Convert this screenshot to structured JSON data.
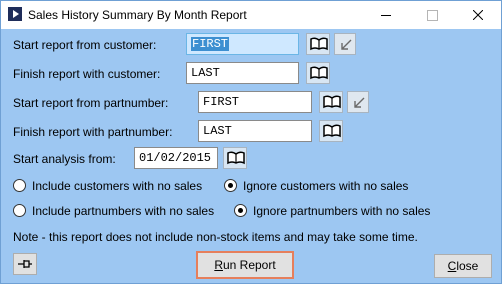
{
  "window": {
    "title": "Sales History Summary By Month Report",
    "controls": [
      "minimize-icon",
      "maximize-icon",
      "close-icon"
    ]
  },
  "form": {
    "start_customer": {
      "label": "Start report from customer:",
      "value": "FIRST"
    },
    "finish_customer": {
      "label": "Finish report with customer:",
      "value": "LAST"
    },
    "start_part": {
      "label": "Start report from partnumber:",
      "value": "FIRST"
    },
    "finish_part": {
      "label": "Finish report with partnumber:",
      "value": "LAST"
    },
    "analysis": {
      "label": "Start analysis from:",
      "value": "01/02/2015"
    }
  },
  "options": {
    "customers": {
      "include": {
        "label": "Include customers with no sales",
        "selected": false
      },
      "ignore": {
        "label": "Ignore customers with no sales",
        "selected": true
      }
    },
    "partnumbers": {
      "include": {
        "label": "Include partnumbers with no sales",
        "selected": false
      },
      "ignore": {
        "label": "Ignore partnumbers with no sales",
        "selected": true
      }
    }
  },
  "note": "Note - this report does not include non-stock items and may take some time.",
  "buttons": {
    "run_prefix": "R",
    "run_rest": "un Report",
    "close_prefix": "C",
    "close_rest": "lose"
  },
  "icons": {
    "lookup": "book-icon",
    "copy_down": "arrow-down-left-icon",
    "pin": "pin-icon"
  },
  "colors": {
    "window_bg": "#9dc7f2",
    "focus_field_bg": "#cfe8ff",
    "selection": "#3d8fd1",
    "default_button_border": "#e67f5c"
  }
}
